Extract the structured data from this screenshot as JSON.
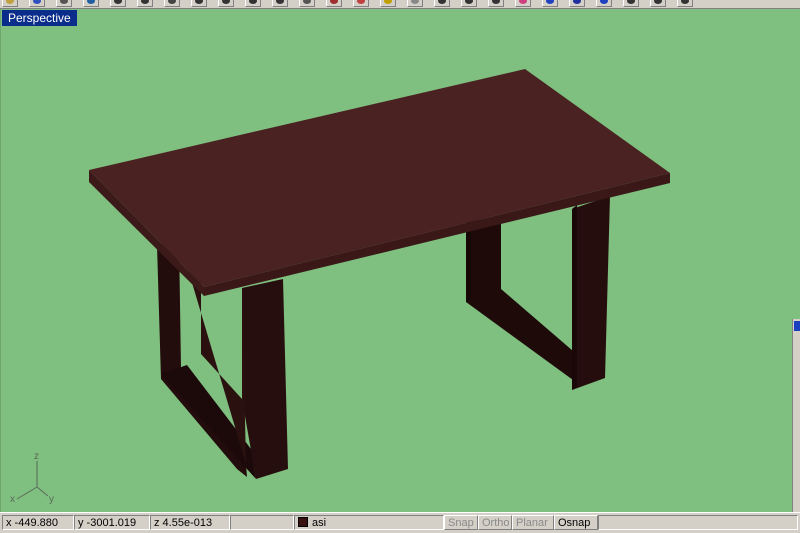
{
  "viewport": {
    "title": "Perspective",
    "background_color": "#7fbf7f",
    "axes": {
      "z": "z",
      "x": "x",
      "y": "y"
    }
  },
  "model": {
    "top_color": "#4a2222",
    "top_edge_color": "#5a2a2a",
    "leg_color": "#230c0c",
    "leg_shadow_color": "#1a0808"
  },
  "status": {
    "x": "x -449.880",
    "y": "y -3001.019",
    "z": "z 4.55e-013",
    "layer_name": "asi",
    "layer_color": "#3a1212",
    "snap": "Snap",
    "ortho": "Ortho",
    "planar": "Planar",
    "osnap": "Osnap"
  },
  "toolbar": {
    "icons": [
      "folder-icon",
      "save-icon",
      "print-icon",
      "undo-icon",
      "pointer-icon",
      "select-icon",
      "rotate-icon",
      "zoom-icon",
      "zoom-window-icon",
      "pan-icon",
      "zoom-extents-icon",
      "grid-icon",
      "shade-icon",
      "render-icon",
      "light-icon",
      "sphere-icon",
      "point-icon",
      "curve-icon",
      "edit-icon",
      "color-wheel-icon",
      "render-blue-icon",
      "sphere-blue-icon",
      "material-icon",
      "layer-icon",
      "properties-icon",
      "help-icon"
    ]
  }
}
